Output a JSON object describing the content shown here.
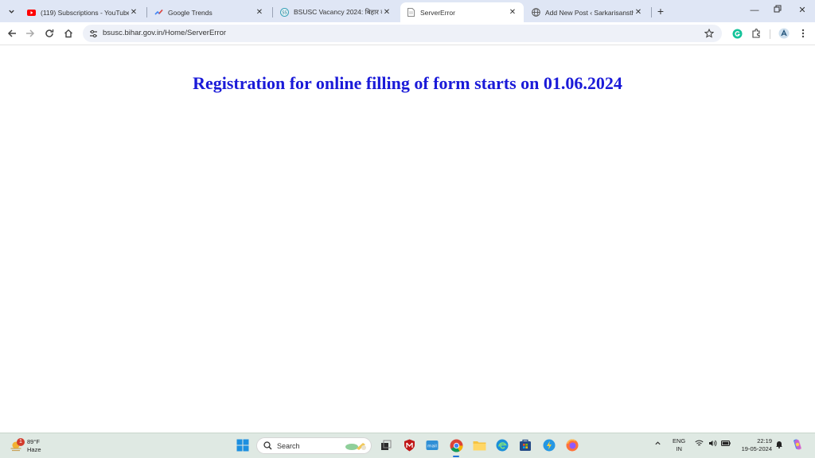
{
  "browser": {
    "tabs": [
      {
        "label": "(119) Subscriptions - YouTube",
        "favicon": "youtube-icon"
      },
      {
        "label": "Google Trends",
        "favicon": "trends-icon"
      },
      {
        "label": "BSUSC Vacancy 2024: बिहार की",
        "favicon": "site-icon"
      },
      {
        "label": "ServerError",
        "favicon": "page-icon",
        "active": true
      },
      {
        "label": "Add New Post ‹ Sarkarisanstha",
        "favicon": "globe-icon"
      }
    ],
    "url": "bsusc.bihar.gov.in/Home/ServerError"
  },
  "page": {
    "headline": "Registration for online filling of form starts on 01.06.2024",
    "headline_color": "#1a1ad8"
  },
  "taskbar": {
    "weather_temp": "89°F",
    "weather_desc": "Haze",
    "weather_badge": "1",
    "search_label": "Search",
    "language": "ENG",
    "region": "IN",
    "time": "22:19",
    "date": "19-05-2024"
  }
}
